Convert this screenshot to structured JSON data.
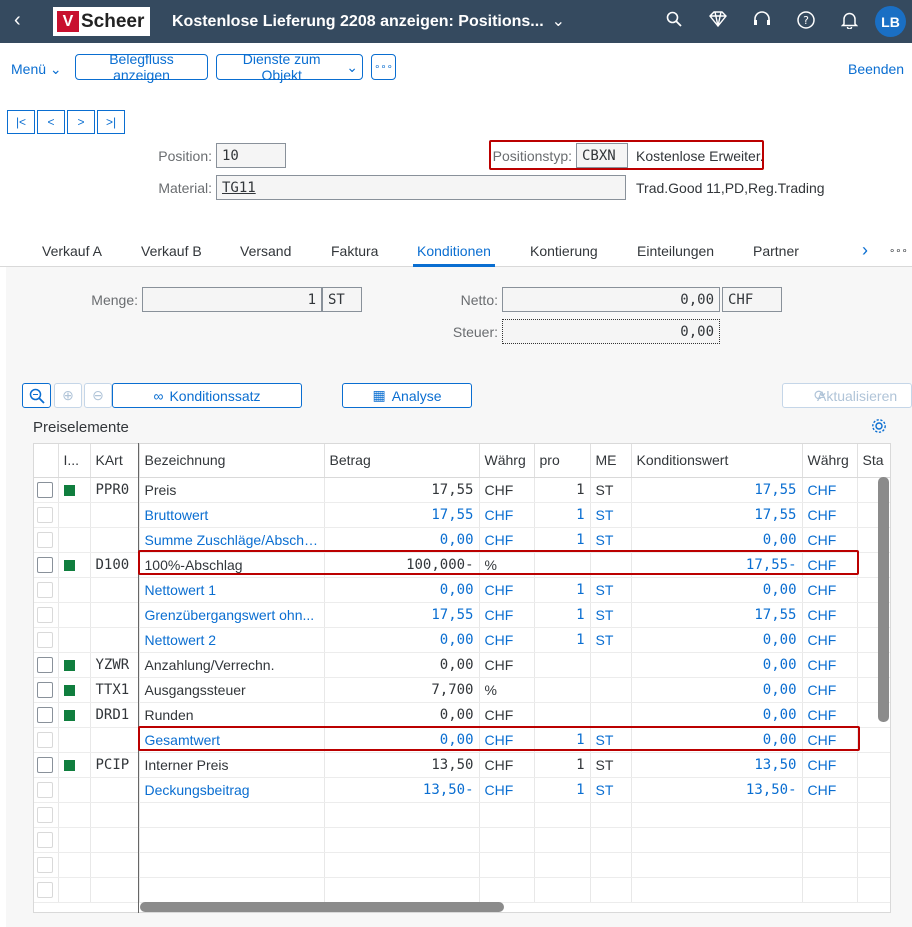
{
  "shell": {
    "back_icon": "‹",
    "logo_v": "V",
    "logo_text": "Scheer",
    "title": "Kostenlose Lieferung 2208 anzeigen: Positions...",
    "title_chevron": "⌄",
    "avatar": "LB"
  },
  "toolbar": {
    "menu": "Menü",
    "belegfluss": "Belegfluss anzeigen",
    "dienste": "Dienste zum Objekt",
    "more": "∘∘∘",
    "beenden": "Beenden"
  },
  "nav": {
    "first": "|<",
    "prev": "<",
    "next": ">",
    "last": ">|"
  },
  "header": {
    "position_label": "Position:",
    "position_value": "10",
    "material_label": "Material:",
    "material_value": "TG11",
    "material_desc": "Trad.Good 11,PD,Reg.Trading",
    "positionstyp_label": "Positionstyp:",
    "positionstyp_code": "CBXN",
    "positionstyp_desc": "Kostenlose Erweiter."
  },
  "tabs": [
    "Verkauf A",
    "Verkauf B",
    "Versand",
    "Faktura",
    "Konditionen",
    "Kontierung",
    "Einteilungen",
    "Partner"
  ],
  "tabs_more": "∘∘∘",
  "cond": {
    "menge_label": "Menge:",
    "menge_value": "1",
    "menge_unit": "ST",
    "netto_label": "Netto:",
    "netto_value": "0,00",
    "netto_cur": "CHF",
    "steuer_label": "Steuer:",
    "steuer_value": "0,00"
  },
  "buttons": {
    "konditionssatz": "Konditionssatz",
    "analyse": "Analyse",
    "aktualisieren": "Aktualisieren"
  },
  "section_title": "Preiselemente",
  "columns": [
    "I...",
    "KArt",
    "Bezeichnung",
    "Betrag",
    "Währg",
    "pro",
    "ME",
    "Konditionswert",
    "Währg",
    "Sta"
  ],
  "rows": [
    {
      "cb": "on",
      "ind": true,
      "kart": "PPR0",
      "bez": "Preis",
      "betrag": "17,55",
      "waehrg": "CHF",
      "pro": "1",
      "me": "ST",
      "kwert": "17,55",
      "kwaehrg": "CHF",
      "link": false
    },
    {
      "cb": "dis",
      "ind": false,
      "kart": "",
      "bez": "Bruttowert",
      "betrag": "17,55",
      "waehrg": "CHF",
      "pro": "1",
      "me": "ST",
      "kwert": "17,55",
      "kwaehrg": "CHF",
      "link": true
    },
    {
      "cb": "dis",
      "ind": false,
      "kart": "",
      "bez": "Summe Zuschläge/Abschl...",
      "betrag": "0,00",
      "waehrg": "CHF",
      "pro": "1",
      "me": "ST",
      "kwert": "0,00",
      "kwaehrg": "CHF",
      "link": true
    },
    {
      "cb": "on",
      "ind": true,
      "kart": "D100",
      "bez": "100%-Abschlag",
      "betrag": "100,000-",
      "waehrg": "%",
      "pro": "",
      "me": "",
      "kwert": "17,55-",
      "kwaehrg": "CHF",
      "link": false
    },
    {
      "cb": "dis",
      "ind": false,
      "kart": "",
      "bez": "Nettowert 1",
      "betrag": "0,00",
      "waehrg": "CHF",
      "pro": "1",
      "me": "ST",
      "kwert": "0,00",
      "kwaehrg": "CHF",
      "link": true
    },
    {
      "cb": "dis",
      "ind": false,
      "kart": "",
      "bez": "Grenzübergangswert ohn...",
      "betrag": "17,55",
      "waehrg": "CHF",
      "pro": "1",
      "me": "ST",
      "kwert": "17,55",
      "kwaehrg": "CHF",
      "link": true
    },
    {
      "cb": "dis",
      "ind": false,
      "kart": "",
      "bez": "Nettowert 2",
      "betrag": "0,00",
      "waehrg": "CHF",
      "pro": "1",
      "me": "ST",
      "kwert": "0,00",
      "kwaehrg": "CHF",
      "link": true
    },
    {
      "cb": "on",
      "ind": true,
      "kart": "YZWR",
      "bez": "Anzahlung/Verrechn.",
      "betrag": "0,00",
      "waehrg": "CHF",
      "pro": "",
      "me": "",
      "kwert": "0,00",
      "kwaehrg": "CHF",
      "link": false
    },
    {
      "cb": "on",
      "ind": true,
      "kart": "TTX1",
      "bez": "Ausgangssteuer",
      "betrag": "7,700",
      "waehrg": "%",
      "pro": "",
      "me": "",
      "kwert": "0,00",
      "kwaehrg": "CHF",
      "link": false
    },
    {
      "cb": "on",
      "ind": true,
      "kart": "DRD1",
      "bez": "Runden",
      "betrag": "0,00",
      "waehrg": "CHF",
      "pro": "",
      "me": "",
      "kwert": "0,00",
      "kwaehrg": "CHF",
      "link": false
    },
    {
      "cb": "dis",
      "ind": false,
      "kart": "",
      "bez": "Gesamtwert",
      "betrag": "0,00",
      "waehrg": "CHF",
      "pro": "1",
      "me": "ST",
      "kwert": "0,00",
      "kwaehrg": "CHF",
      "link": true
    },
    {
      "cb": "on",
      "ind": true,
      "kart": "PCIP",
      "bez": "Interner Preis",
      "betrag": "13,50",
      "waehrg": "CHF",
      "pro": "1",
      "me": "ST",
      "kwert": "13,50",
      "kwaehrg": "CHF",
      "link": false
    },
    {
      "cb": "dis",
      "ind": false,
      "kart": "",
      "bez": "Deckungsbeitrag",
      "betrag": "13,50-",
      "waehrg": "CHF",
      "pro": "1",
      "me": "ST",
      "kwert": "13,50-",
      "kwaehrg": "CHF",
      "link": true
    },
    {
      "cb": "dis",
      "ind": false,
      "kart": "",
      "bez": "",
      "betrag": "",
      "waehrg": "",
      "pro": "",
      "me": "",
      "kwert": "",
      "kwaehrg": "",
      "link": false
    },
    {
      "cb": "dis",
      "ind": false,
      "kart": "",
      "bez": "",
      "betrag": "",
      "waehrg": "",
      "pro": "",
      "me": "",
      "kwert": "",
      "kwaehrg": "",
      "link": false
    },
    {
      "cb": "dis",
      "ind": false,
      "kart": "",
      "bez": "",
      "betrag": "",
      "waehrg": "",
      "pro": "",
      "me": "",
      "kwert": "",
      "kwaehrg": "",
      "link": false
    },
    {
      "cb": "dis",
      "ind": false,
      "kart": "",
      "bez": "",
      "betrag": "",
      "waehrg": "",
      "pro": "",
      "me": "",
      "kwert": "",
      "kwaehrg": "",
      "link": false
    }
  ],
  "colors": {
    "shell": "#354a5f",
    "accent": "#0a6ed1",
    "highlight": "#bb0000",
    "indicator": "#107e3e"
  }
}
